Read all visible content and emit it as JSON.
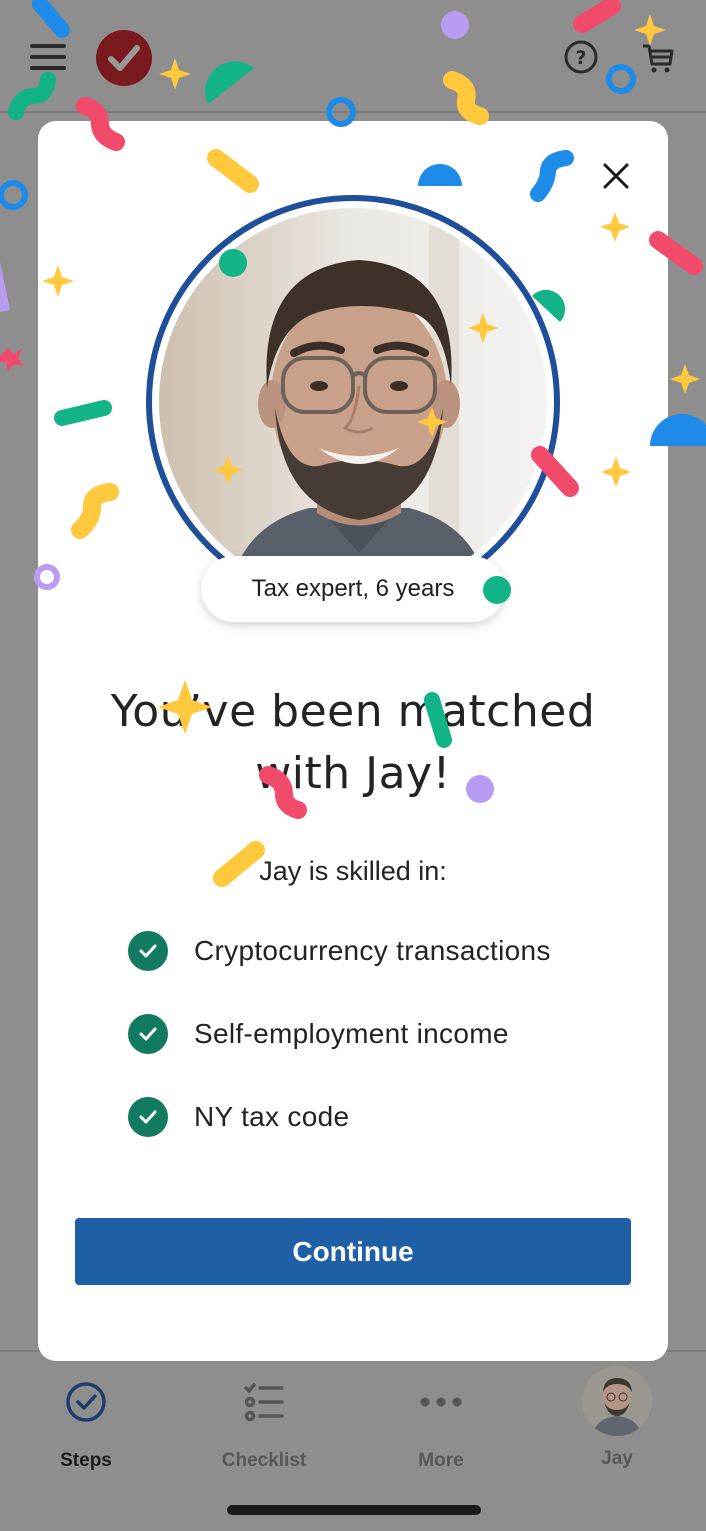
{
  "app": {
    "help_icon": "help-circle-icon",
    "cart_icon": "cart-icon",
    "menu_icon": "hamburger-menu-icon",
    "logo_icon": "checkmark-logo-icon"
  },
  "modal": {
    "badge_text": "Tax expert, 6 years",
    "title_line1": "You’ve been matched",
    "title_line2": "with Jay!",
    "skills_heading": "Jay is skilled in:",
    "skills": [
      "Cryptocurrency transactions",
      "Self-employment income",
      "NY tax code"
    ],
    "continue_label": "Continue"
  },
  "bottom_nav": {
    "items": [
      {
        "label": "Steps",
        "icon": "steps-check-icon",
        "active": true
      },
      {
        "label": "Checklist",
        "icon": "checklist-icon",
        "active": false
      },
      {
        "label": "More",
        "icon": "more-dots-icon",
        "active": false
      },
      {
        "label": "Jay",
        "icon": "expert-avatar",
        "active": false
      }
    ]
  },
  "colors": {
    "overlay": "#8e8e8e",
    "primary": "#1f5fa6",
    "ring": "#1f4f98",
    "check": "#127a60",
    "logo": "#7a1a1e",
    "confetti": [
      "#ffc83d",
      "#f24a6a",
      "#1f8be8",
      "#12b386",
      "#b89cf2"
    ]
  }
}
